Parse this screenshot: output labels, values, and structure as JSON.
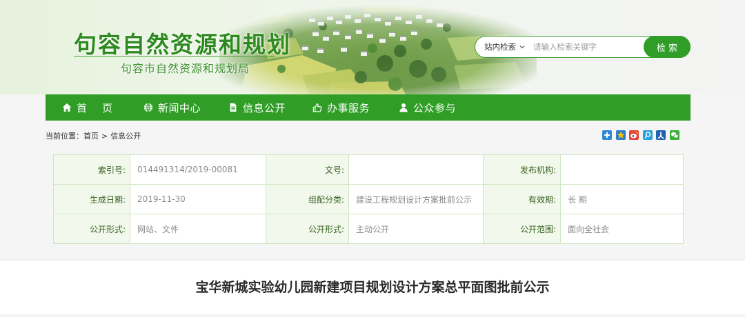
{
  "site": {
    "title": "句容自然资源和规划",
    "subtitle": "句容市自然资源和规划局"
  },
  "search": {
    "scope": "站内检索",
    "scope_icon": "chevron-down-icon",
    "placeholder": "请输入检索关键字",
    "button": "检 索"
  },
  "nav": [
    {
      "label": "首　页",
      "icon": "home-icon"
    },
    {
      "label": "新闻中心",
      "icon": "globe-icon"
    },
    {
      "label": "信息公开",
      "icon": "document-icon"
    },
    {
      "label": "办事服务",
      "icon": "thumbs-up-icon"
    },
    {
      "label": "公众参与",
      "icon": "user-icon"
    }
  ],
  "breadcrumb": {
    "prefix": "当前位置：",
    "items": [
      "首页",
      "信息公开"
    ],
    "separator": ">"
  },
  "share": [
    "share-more-icon",
    "qzone-icon",
    "weibo-icon",
    "tencent-weibo-icon",
    "renren-icon",
    "wechat-icon"
  ],
  "info": {
    "rows": [
      [
        {
          "label": "索引号:",
          "value": "014491314/2019-00081"
        },
        {
          "label": "文号:",
          "value": ""
        },
        {
          "label": "发布机构:",
          "value": ""
        }
      ],
      [
        {
          "label": "生成日期:",
          "value": "2019-11-30"
        },
        {
          "label": "组配分类:",
          "value": "建设工程规划设计方案批前公示"
        },
        {
          "label": "有效期:",
          "value": "长 期"
        }
      ],
      [
        {
          "label": "公开形式:",
          "value": "网站、文件"
        },
        {
          "label": "公开形式:",
          "value": "主动公开"
        },
        {
          "label": "公开范围:",
          "value": "面向全社会"
        }
      ]
    ]
  },
  "article": {
    "title": "宝华新城实验幼儿园新建项目规划设计方案总平面图批前公示"
  },
  "colors": {
    "primary": "#2f9d26",
    "title": "#2c8a1e",
    "table_border": "#cfe5c1",
    "label_bg": "#f2f9ec"
  }
}
